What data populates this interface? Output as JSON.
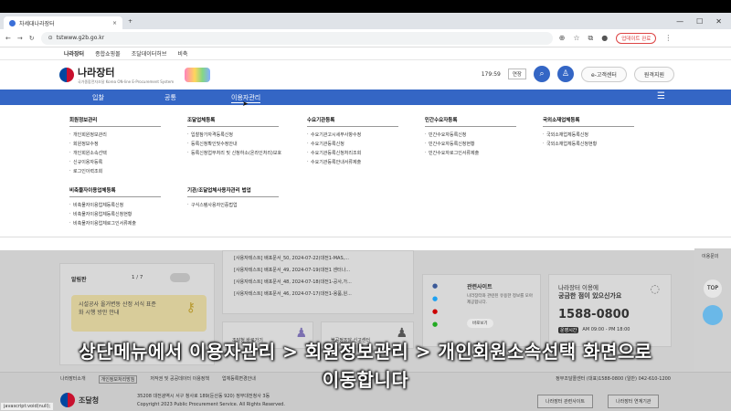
{
  "browser": {
    "tab_title": "차세대나라장터",
    "url": "tstwww.g2b.go.kr",
    "update_label": "업데이트 완료"
  },
  "site": {
    "util_links": [
      "나라장터",
      "종합쇼핑몰",
      "조달데이터허브",
      "비축"
    ],
    "logo_text": "나라장터",
    "logo_sub": "국가종합전자조달 Korea ON-line E-Procurement System",
    "timer": "179:59",
    "extend_label": "연장",
    "customer_center": "e-고객센터",
    "remote_support": "원격지원"
  },
  "nav": {
    "items": [
      "입찰",
      "공통",
      "이용자관리"
    ],
    "active": "이용자관리"
  },
  "mega_menu": [
    {
      "title": "회원정보관리",
      "items": [
        "개인회원정보관리",
        "회원정보수정",
        "개인회원소속선택",
        "신규이용자등록",
        "로그인이력조회"
      ]
    },
    {
      "title": "조달업체등록",
      "items": [
        "입찰참가자격등록신청",
        "등록신청확인및수정안내",
        "등록신청업무처리 및 신청하소(온라인처리)보호"
      ]
    },
    {
      "title": "수요기관등록",
      "items": [
        "수요기관고시세부사항수정",
        "수요기관등록신청",
        "수요기관등록신청처리조회",
        "수요기관등록안내서류제출"
      ]
    },
    {
      "title": "민간수요자등록",
      "items": [
        "민간수요자등록신청",
        "민간수요자등록신청현황",
        "민간수요자로그인서류제출"
      ]
    },
    {
      "title": "국외소재업체등록",
      "items": [
        "국외소재업체등록신청",
        "국외소재업체등록신청현황"
      ]
    },
    {
      "title": "비축물자이용업체등록",
      "items": [
        "비축물자이용업체등록신청",
        "비축물자이용업체등록신청현황",
        "비축물자이용업체로그인서류제출"
      ]
    },
    {
      "title": "기관/조달업체사용자관리 법업",
      "items": [
        "구식스템사용자인증법업"
      ]
    }
  ],
  "page": {
    "alarm_title": "알림판",
    "pager": "1 / 7",
    "notice_card": "시설공사 올거변동 산정 서식 표준화 시행 방안 안내",
    "notices": [
      "[사용자테스트] 배포문서_50, 2024-07-22(대전1-MAS,...",
      "[사용자테스트] 배포문서_49, 2024-07-19(대전1 센터나...",
      "[사용자테스트] 배포문서_48, 2024-07-18(대전1-공사,가...",
      "[사용자테스트] 배포문서_46, 2024-07-17(대전1-용품,원..."
    ],
    "shortcut1": "조달청 바로가기",
    "shortcut2": "불공정조달 신고센터",
    "related_title": "관련사이트",
    "related_desc": "나라장터와 관련된 유용한 정보를 모아 제공합니다.",
    "related_btn": "바로보기",
    "help_title": "나라장터 이용에",
    "help_sub": "궁금한 점이 있으신가요",
    "phone": "1588-0800",
    "hours_label": "운영시간",
    "hours": "AM 09:00 - PM 18:00",
    "side_label": "이용문의",
    "top_label": "TOP"
  },
  "footer": {
    "links": [
      "나라장터소개",
      "개인정보처리방침",
      "저작권 및 공공데이터 이용정책",
      "업체등록변경안내"
    ],
    "org": "조달청",
    "address": "35208 대전광역시 서구 청사로 189(둔산동 920) 정부대전청사 3동",
    "copyright": "Copyright 2023 Public Procurement Service. All Rights Reserved.",
    "contact": "정부조달콜센터 (대표)1588-0800 (일반) 042-610-1200",
    "btn1": "나라장터 관련사이트",
    "btn2": "나라장터 연계기관"
  },
  "subtitle": {
    "line1": "상단메뉴에서 이용자관리 > 회원정보관리 > 개인회원소속선택 화면으로",
    "line2": "이동합니다"
  },
  "status_url": "javascript:void(null);"
}
